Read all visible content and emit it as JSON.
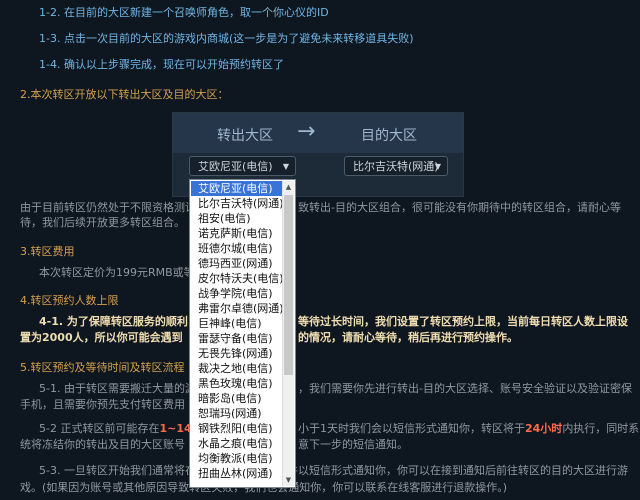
{
  "lines": {
    "step12": "1-2. 在目前的大区新建一个召唤师角色，取一个你心仪的ID",
    "step13": "1-3. 点击一次目前的大区的游戏内商城(这一步是为了避免未来转移道具失败)",
    "step14": "1-4. 确认以上步骤完成，现在可以开始预约转区了",
    "h2": "2.本次转区开放以下转出大区及目的大区：",
    "note_a": "由于目前转区仍然处于不限资格测试",
    "note_b": "致转出-目的大区组合，很可能没有你期待中的转区组合，请耐心等",
    "note_c": "待，我们后续开放更多转区组合。",
    "h3": "3.转区费用",
    "fee": "本次转区定价为199元RMB或等价",
    "h4": "4.转区预约人数上限",
    "l41a_1": "4-1. 为了保障转区服务的顺利",
    "l41a_2": "等待过长时间，我们设置了转区预约上限，当前每日转区人数上限设",
    "l41b_1": "置为2000人，所以你可能会遇到",
    "l41b_2": "的情况，请耐心等待，稍后再进行预约操作。",
    "h5": "5.转区预约及等待时间及转区流程",
    "l51a_1": "5-1. 由于转区需要搬迁大量的游",
    "l51a_2": "，我们需要你先进行转出-目的大区选择、账号安全验证以及验证密保",
    "l51b_1": "手机，且需要你预先支付转区费用",
    "l52a_1": "5-2 正式转区前可能存在",
    "l52a_red1": "1~14天",
    "l52a_2": "小于1天时我们会以短信形式通知你，转区将于",
    "l52a_red2": "24小时",
    "l52a_3": "内执行，同时系",
    "l52b_1": "统将冻结你的转出及目的大区账号",
    "l52b_2": "意下一步的短信通知。",
    "l53a_1": "5-3. 一旦转区开始我们通常将在72小时内完成转区并以短信形式通知你，你可以在接到通知后前往转区的目的大区进行游",
    "l53b_1": "戏。(如果因为账号或其他原因导致转区失败，我们也会通知你，你可以联系在线客服进行退款操作。)"
  },
  "panel": {
    "from_label": "转出大区",
    "arrow": "→",
    "to_label": "目的大区"
  },
  "select_from": {
    "value": "艾欧尼亚(电信)",
    "caret": "▼"
  },
  "select_to": {
    "value": "比尔吉沃特(网通)",
    "caret": "▼"
  },
  "dropdown": {
    "items": [
      "艾欧尼亚(电信)",
      "比尔吉沃特(网通)",
      "祖安(电信)",
      "诺克萨斯(电信)",
      "班德尔城(电信)",
      "德玛西亚(网通)",
      "皮尔特沃夫(电信)",
      "战争学院(电信)",
      "弗雷尔卓德(网通)",
      "巨神峰(电信)",
      "雷瑟守备(电信)",
      "无畏先锋(网通)",
      "裁决之地(电信)",
      "黑色玫瑰(电信)",
      "暗影岛(电信)",
      "恕瑞玛(网通)",
      "钢铁烈阳(电信)",
      "水晶之痕(电信)",
      "均衡教派(电信)",
      "扭曲丛林(网通)"
    ],
    "selected_index": 0
  },
  "colors": {
    "page_bg": "#0e1620",
    "heading_gold": "#d4a04c",
    "link_blue": "#6fb6e6",
    "highlight_red": "#ff6a4a",
    "dropdown_selected": "#3874d8"
  }
}
